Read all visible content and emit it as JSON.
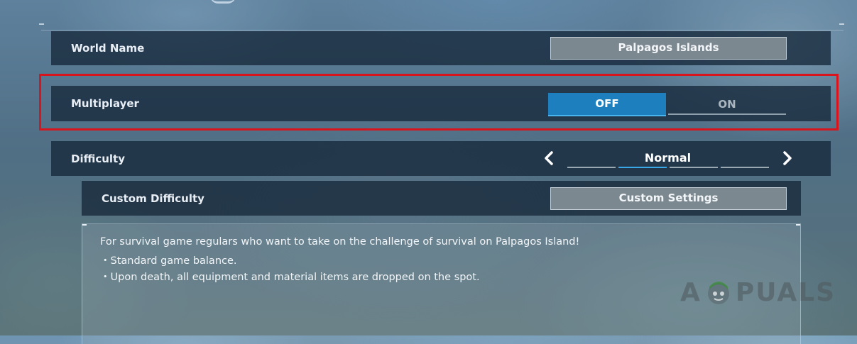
{
  "settings": {
    "world_name": {
      "label": "World Name",
      "value": "Palpagos Islands"
    },
    "multiplayer": {
      "label": "Multiplayer",
      "options": [
        "OFF",
        "ON"
      ],
      "selected": "OFF"
    },
    "difficulty": {
      "label": "Difficulty",
      "value": "Normal",
      "level_count": 4,
      "selected_level": 2
    },
    "custom_difficulty": {
      "label": "Custom Difficulty",
      "button_label": "Custom Settings"
    }
  },
  "description": {
    "lines": [
      "For survival game regulars who want to take on the challenge of survival on Palpagos Island!",
      "・Standard game balance.",
      "・Upon death, all equipment and material items are dropped on the spot."
    ]
  },
  "highlight_color": "#d8141c",
  "accent_color": "#1e7fbf",
  "watermark": {
    "text_left": "A",
    "text_right": "PUALS"
  },
  "icons": {
    "prev": "chevron-left-icon",
    "next": "chevron-right-icon"
  }
}
